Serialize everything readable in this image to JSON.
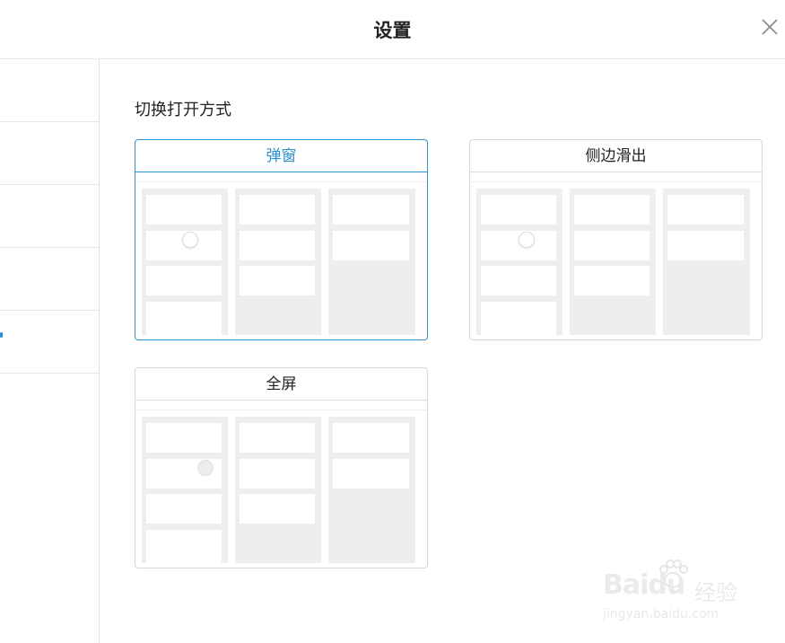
{
  "dialog": {
    "title": "设置",
    "close_icon": "close-icon"
  },
  "sidebar": {
    "items": [
      {
        "label": ""
      },
      {
        "label": ""
      },
      {
        "label": ""
      },
      {
        "label": ""
      },
      {
        "label": ""
      }
    ],
    "active_index": 3,
    "accent": "#1a8ed6"
  },
  "main": {
    "section_label": "切换打开方式",
    "options": [
      {
        "label": "弹窗",
        "selected": true
      },
      {
        "label": "侧边滑出",
        "selected": false
      },
      {
        "label": "全屏",
        "selected": false
      }
    ],
    "accent": "#2a93d5"
  },
  "watermark": {
    "brand": "Baidu",
    "cn": "经验",
    "url": "jingyan.baidu.com"
  }
}
